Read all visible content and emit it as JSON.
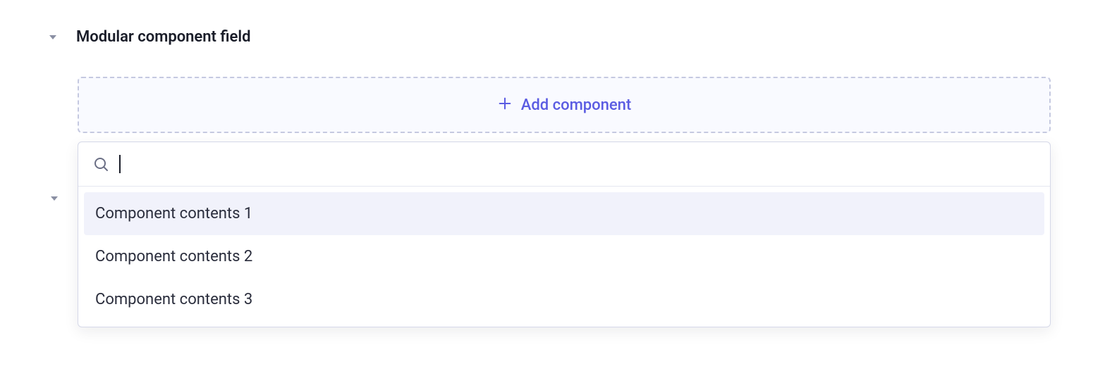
{
  "field": {
    "title": "Modular component field"
  },
  "addButton": {
    "label": "Add component"
  },
  "search": {
    "value": "",
    "placeholder": ""
  },
  "options": [
    {
      "label": "Component contents 1",
      "highlighted": true
    },
    {
      "label": "Component contents 2",
      "highlighted": false
    },
    {
      "label": "Component contents 3",
      "highlighted": false
    }
  ]
}
